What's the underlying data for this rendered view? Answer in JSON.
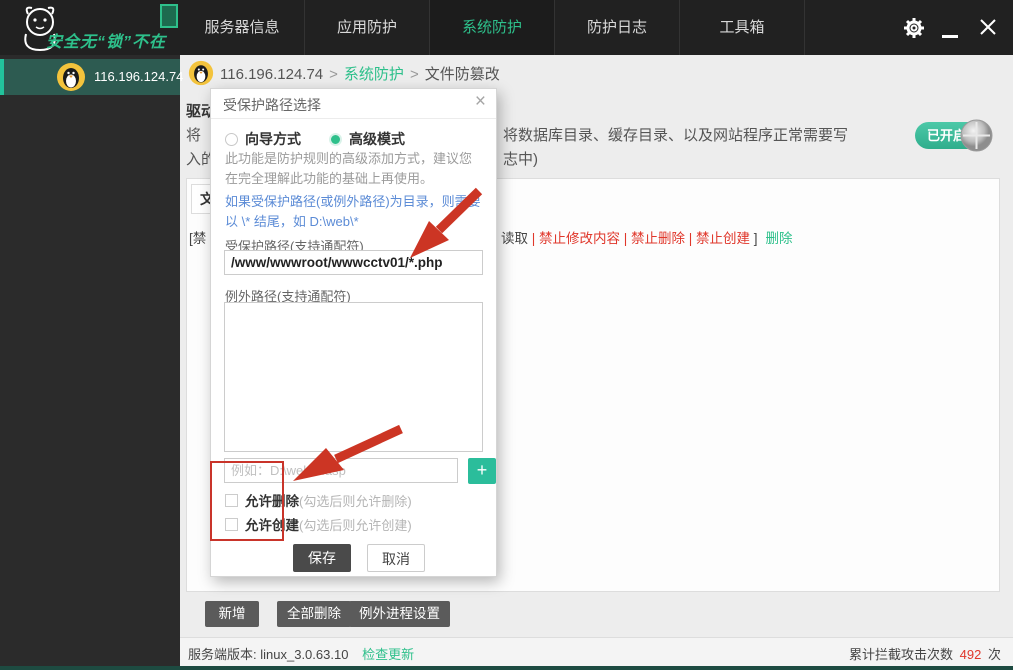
{
  "topbar": {
    "logo_text": "安全无“锁”不在",
    "tabs": [
      {
        "label": "服务器信息"
      },
      {
        "label": "应用防护"
      },
      {
        "label": "系统防护"
      },
      {
        "label": "防护日志"
      },
      {
        "label": "工具箱"
      }
    ]
  },
  "sidebar": {
    "server_ip": "116.196.124.74"
  },
  "breadcrumb": {
    "ip": "116.196.124.74",
    "sep": ">",
    "section": "系统防护",
    "page": "文件防篡改"
  },
  "content": {
    "heading_fragment": "驱动",
    "para_left_1": "将",
    "para_left_2": "入的",
    "para_right_1": "将数据库目录、缓存目录、以及网站程序正常需要写",
    "para_right_2": "志中)",
    "toggle_label": "已开启",
    "tab_label": "文件防篡改",
    "rule": {
      "left_fragment": "[禁",
      "prefix": "读取",
      "red_part": " | 禁止修改内容 | 禁止删除 | 禁止创建",
      "bracket": " ]",
      "delete_link": "删除"
    },
    "buttons": {
      "add": "新增",
      "delete_all": "全部删除",
      "exception_proc": "例外进程设置"
    }
  },
  "modal": {
    "title": "受保护路径选择",
    "close": "×",
    "radio_wizard": "向导方式",
    "radio_advanced": "高级模式",
    "note_gray": "此功能是防护规则的高级添加方式，建议您在完全理解此功能的基础上再使用。",
    "note_blue": "如果受保护路径(或例外路径)为目录，则需要以 \\* 结尾，如 D:\\web\\*",
    "path_label": "受保护路径(支持通配符)",
    "path_value": "/www/wwwroot/wwwcctv01/*.php",
    "exception_label": "例外路径(支持通配符)",
    "add_placeholder": "例如：D:\\web\\1.asp",
    "add_button": "+",
    "checkbox_delete": {
      "label": "允许删除",
      "hint": "(勾选后则允许删除)"
    },
    "checkbox_create": {
      "label": "允许创建",
      "hint": "(勾选后则允许创建)"
    },
    "save": "保存",
    "cancel": "取消"
  },
  "statusbar": {
    "version_label": "服务端版本:",
    "version": "linux_3.0.63.10",
    "check_update": "检查更新",
    "stats_label": "累计拦截攻击次数",
    "stats_value": "492",
    "stats_unit": "次"
  },
  "colors": {
    "accent": "#2ec08b",
    "red": "#e0372b",
    "blue": "#5b8bd6",
    "annotation": "#c9342a"
  }
}
